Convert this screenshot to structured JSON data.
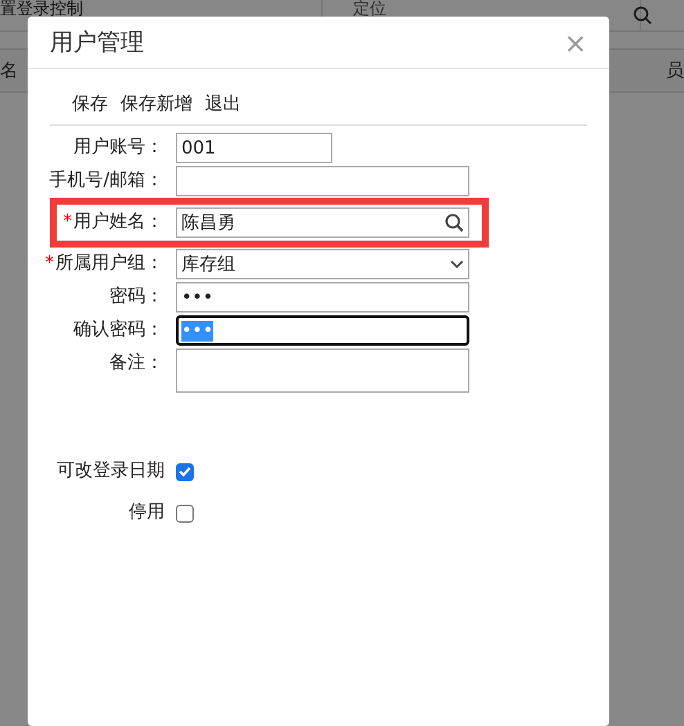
{
  "background": {
    "heading": "置登录控制",
    "search": {
      "placeholder": "定位"
    },
    "columns": [
      "名",
      "员"
    ]
  },
  "dialog": {
    "title": "用户管理",
    "close": "×",
    "toolbar": [
      "保存",
      "保存新增",
      "退出"
    ],
    "fields": [
      {
        "label": "用户账号：",
        "kind": "text",
        "value": "001",
        "focused": false,
        "highlighted": false
      },
      {
        "label": "手机号/邮箱：",
        "kind": "text",
        "focused": false,
        "highlighted": false
      },
      {
        "label": "用户姓名：",
        "required_mark": "*",
        "kind": "lookup",
        "value": "陈昌勇",
        "focused": false,
        "highlighted": true
      },
      {
        "label": "所属用户组：",
        "required_mark": "*",
        "kind": "select",
        "value": "库存组",
        "focused": false,
        "highlighted": false
      },
      {
        "label": "密码：",
        "kind": "password",
        "value": "•••",
        "focused": false,
        "highlighted": false
      },
      {
        "label": "确认密码：",
        "kind": "password",
        "value": "•••",
        "focused": true,
        "highlighted": false
      },
      {
        "label": "备注：",
        "kind": "textarea",
        "focused": false,
        "highlighted": false
      }
    ],
    "checks": [
      {
        "label": "可改登录日期",
        "checked": true
      },
      {
        "label": "停用",
        "checked": false
      }
    ]
  }
}
